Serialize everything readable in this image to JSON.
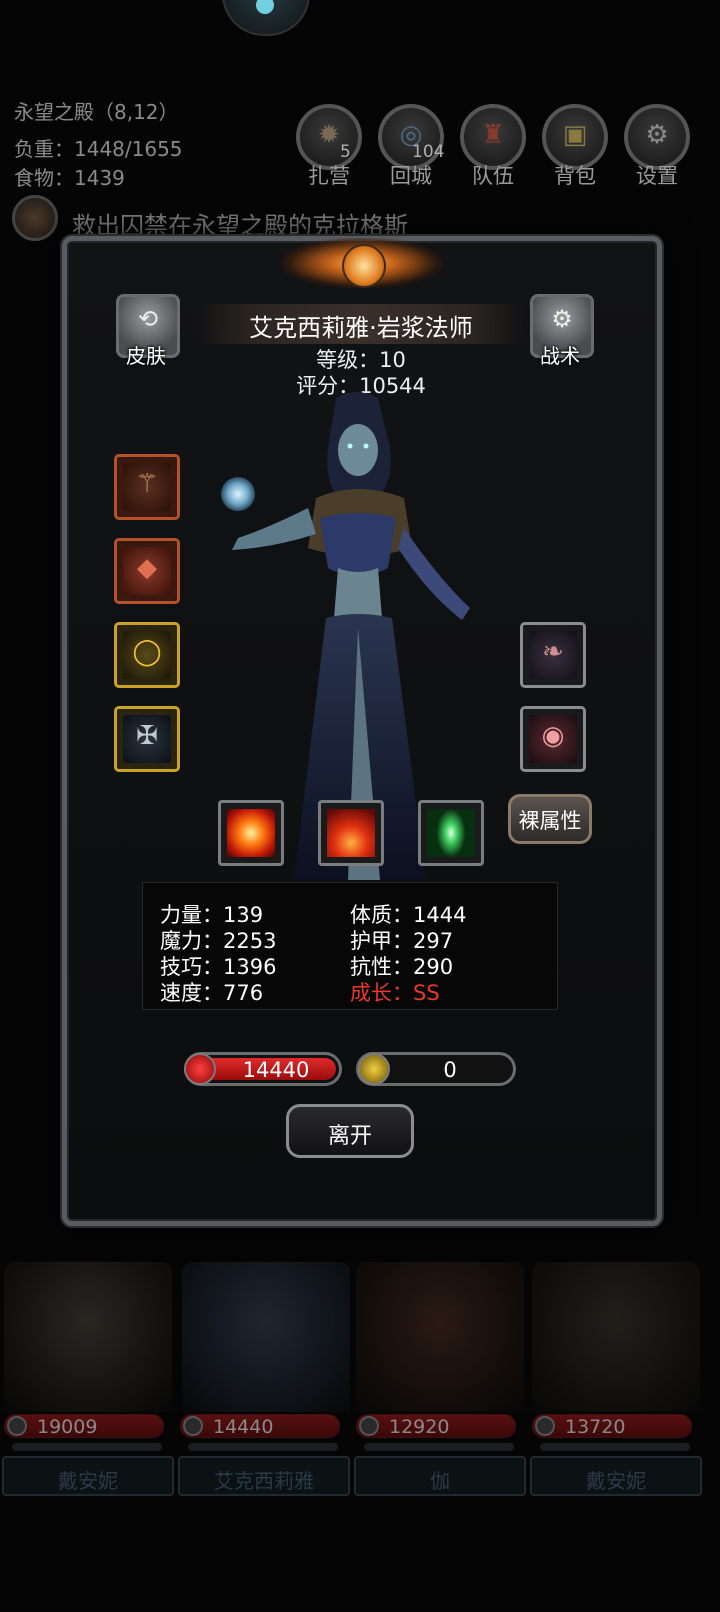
{
  "hud": {
    "location": "永望之殿（8,12）",
    "load": "负重：1448/1655",
    "food": "食物：1439",
    "buttons": [
      {
        "label": "扎营",
        "badge": "5",
        "icon": "campfire-icon"
      },
      {
        "label": "回城",
        "badge": "104",
        "icon": "portal-icon"
      },
      {
        "label": "队伍",
        "badge": "",
        "icon": "team-icon"
      },
      {
        "label": "背包",
        "badge": "",
        "icon": "bag-icon"
      },
      {
        "label": "设置",
        "badge": "",
        "icon": "gear-icon"
      }
    ],
    "quest": "救出囚禁在永望之殿的克拉格斯"
  },
  "hero": {
    "skin_label": "皮肤",
    "tactics_label": "战术",
    "name": "艾克西莉雅·岩浆法师",
    "level": "等级：10",
    "score": "评分：10544",
    "naked_label": "裸属性",
    "stats_left": [
      "力量：139",
      "魔力：2253",
      "技巧：1396",
      "速度：776"
    ],
    "stats_right": [
      "体质：1444",
      "护甲：297",
      "抗性：290"
    ],
    "growth": "成长：SS",
    "hp": "14440",
    "energy": "0",
    "leave_label": "离开",
    "equipment_left": [
      "staff-icon",
      "armor-icon",
      "ring-icon",
      "amulet-icon"
    ],
    "equipment_right": [
      "feather-icon",
      "eye-icon"
    ],
    "skills": [
      "fire-burst-icon",
      "flame-icon",
      "green-crystal-icon"
    ]
  },
  "party": [
    {
      "hp": "19009",
      "name": "戴安妮"
    },
    {
      "hp": "14440",
      "name": "艾克西莉雅"
    },
    {
      "hp": "12920",
      "name": "伽"
    },
    {
      "hp": "13720",
      "name": "戴安妮"
    }
  ],
  "colors": {
    "growth": "#e8392a",
    "hp_fill": "#c8161c",
    "gold_border": "#c9a227",
    "rust_border": "#b4502a"
  }
}
